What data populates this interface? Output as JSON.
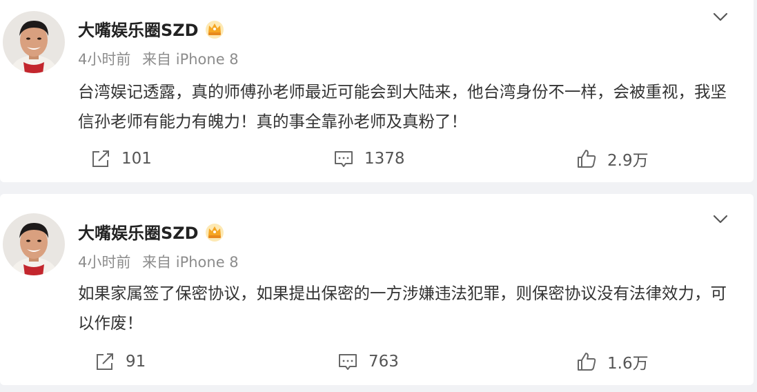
{
  "posts": [
    {
      "author": "大嘴娱乐圈SZD",
      "badge_icon": "crown-badge-icon",
      "time": "4小时前",
      "source": "来自 iPhone 8",
      "content": "台湾娱记透露，真的师傅孙老师最近可能会到大陆来，他台湾身份不一样，会被重视，我坚信孙老师有能力有魄力！真的事全靠孙老师及真粉了！",
      "reposts": "101",
      "comments": "1378",
      "likes": "2.9万"
    },
    {
      "author": "大嘴娱乐圈SZD",
      "badge_icon": "crown-badge-icon",
      "time": "4小时前",
      "source": "来自 iPhone 8",
      "content": "如果家属签了保密协议，如果提出保密的一方涉嫌违法犯罪，则保密协议没有法律效力，可以作废！",
      "reposts": "91",
      "comments": "763",
      "likes": "1.6万"
    }
  ],
  "colors": {
    "background": "#f1f2f5",
    "card": "#ffffff",
    "text": "#333333",
    "meta": "#8c8c8c",
    "badge": "#f5a623"
  }
}
